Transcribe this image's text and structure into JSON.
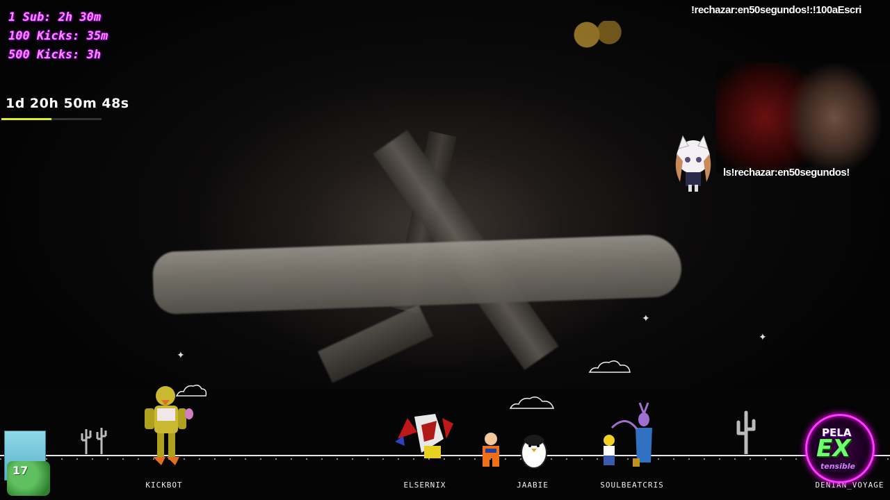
{
  "overlay": {
    "goals": [
      "1 Sub: 2h 30m",
      "100 Kicks: 35m",
      "500 Kicks: 3h"
    ],
    "timer": "1d 20h 50m 48s",
    "timer_progress": 0.5,
    "ticker_top": "!rechazar:en50segundos!:!100aEscri",
    "ticker_mid": "ls!rechazar:en50segundos!"
  },
  "avatars": {
    "level": "17",
    "players": [
      {
        "name": "KICKBOT"
      },
      {
        "name": "ELSERNIX"
      },
      {
        "name": "JAABIE"
      },
      {
        "name": "SOULBEATCRIS"
      },
      {
        "name": "DENIAN_VOYAGE"
      }
    ]
  },
  "logo": {
    "top": "PELA",
    "mid": "EX",
    "bottom": "tensible"
  },
  "colors": {
    "goal_text": "#ff8cff",
    "timer_bar": "#d8f020",
    "logo_ring": "#ff3aff",
    "logo_ex": "#6dff6d"
  }
}
